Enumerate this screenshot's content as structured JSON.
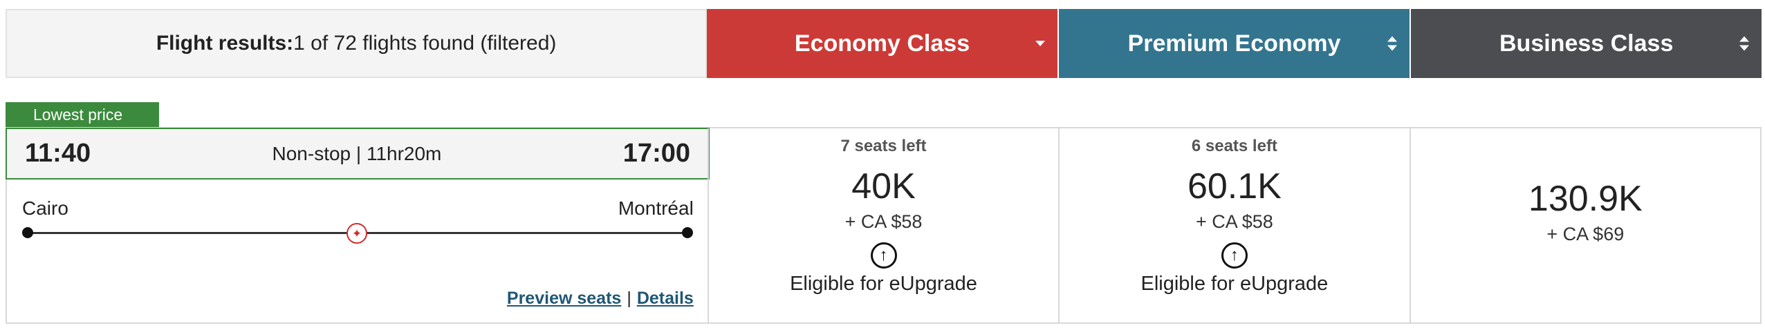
{
  "header": {
    "results_label": "Flight results:",
    "results_text": "1 of 72 flights found (filtered)",
    "tabs": [
      {
        "label": "Economy Class",
        "color": "#cc3a37",
        "sort": "down"
      },
      {
        "label": "Premium Economy",
        "color": "#33758f",
        "sort": "both"
      },
      {
        "label": "Business Class",
        "color": "#4c4d51",
        "sort": "both"
      }
    ]
  },
  "flight": {
    "badge": "Lowest price",
    "depart_time": "11:40",
    "arrive_time": "17:00",
    "duration": "Non-stop | 11hr20m",
    "origin": "Cairo",
    "destination": "Montréal",
    "airline_icon": "maple-leaf-icon",
    "preview_seats": "Preview seats",
    "separator": "|",
    "details": "Details"
  },
  "fares": {
    "economy": {
      "seats": "7 seats left",
      "points": "40K",
      "cash": "+  CA $58",
      "upgrade": "Eligible for eUpgrade"
    },
    "premium": {
      "seats": "6 seats left",
      "points": "60.1K",
      "cash": "+  CA $58",
      "upgrade": "Eligible for eUpgrade"
    },
    "business": {
      "points": "130.9K",
      "cash": "+  CA $69"
    }
  }
}
